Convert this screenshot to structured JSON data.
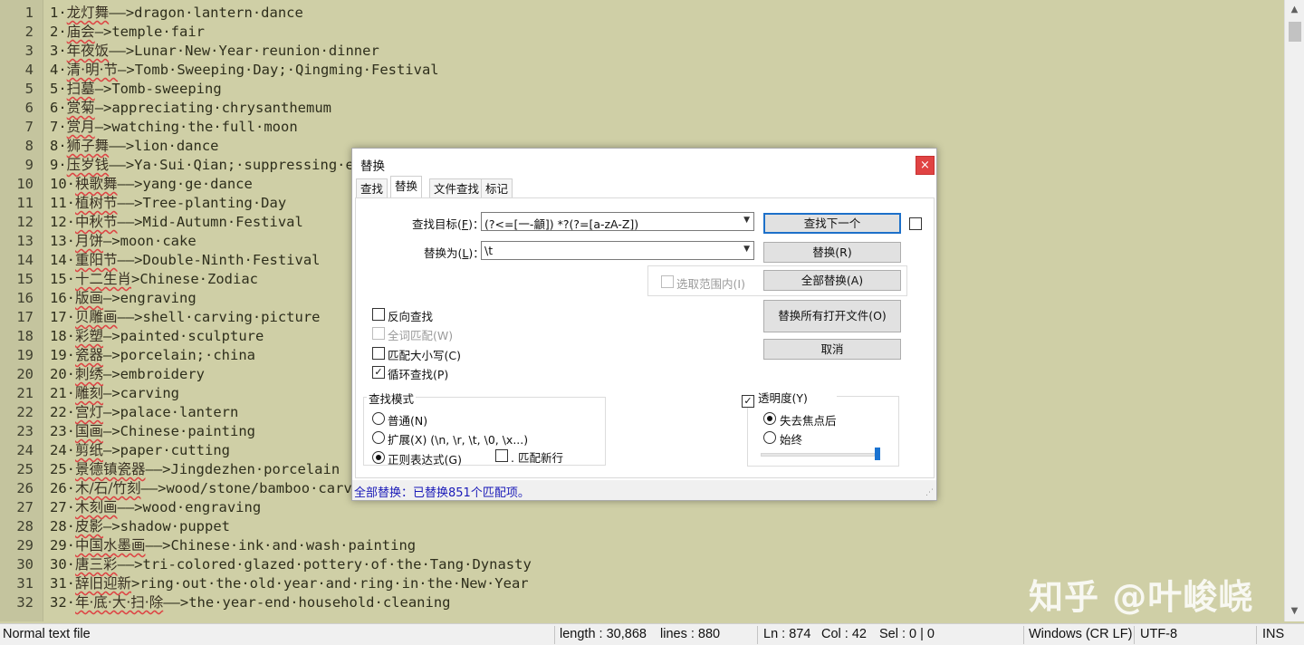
{
  "editor": {
    "lines": [
      {
        "no": "1",
        "pre": "1·",
        "zh": "龙灯舞",
        "post": "——>dragon·lantern·dance"
      },
      {
        "no": "2",
        "pre": "2·",
        "zh": "庙会",
        "post": "—>temple·fair"
      },
      {
        "no": "3",
        "pre": "3·",
        "zh": "年夜饭",
        "post": "——>Lunar·New·Year·reunion·dinner"
      },
      {
        "no": "4",
        "pre": "4·",
        "zh": "清·明·节",
        "post": "—>Tomb·Sweeping·Day;·Qingming·Festival"
      },
      {
        "no": "5",
        "pre": "5·",
        "zh": "扫墓",
        "post": "—>Tomb-sweeping"
      },
      {
        "no": "6",
        "pre": "6·",
        "zh": "赏菊",
        "post": "—>appreciating·chrysanthemum"
      },
      {
        "no": "7",
        "pre": "7·",
        "zh": "赏月",
        "post": "—>watching·the·full·moon"
      },
      {
        "no": "8",
        "pre": "8·",
        "zh": "狮子舞",
        "post": "——>lion·dance"
      },
      {
        "no": "9",
        "pre": "9·",
        "zh": "压岁钱",
        "post": "——>Ya·Sui·Qian;·suppressing·evil·spirits"
      },
      {
        "no": "10",
        "pre": "10·",
        "zh": "秧歌舞",
        "post": "——>yang·ge·dance"
      },
      {
        "no": "11",
        "pre": "11·",
        "zh": "植树节",
        "post": "——>Tree-planting·Day"
      },
      {
        "no": "12",
        "pre": "12·",
        "zh": "中秋节",
        "post": "——>Mid-Autumn·Festival"
      },
      {
        "no": "13",
        "pre": "13·",
        "zh": "月饼",
        "post": "—>moon·cake"
      },
      {
        "no": "14",
        "pre": "14·",
        "zh": "重阳节",
        "post": "——>Double-Ninth·Festival"
      },
      {
        "no": "15",
        "pre": "15·",
        "zh": "十二生肖",
        "post": ">Chinese·Zodiac"
      },
      {
        "no": "16",
        "pre": "16·",
        "zh": "版画",
        "post": "—>engraving"
      },
      {
        "no": "17",
        "pre": "17·",
        "zh": "贝雕画",
        "post": "——>shell·carving·picture"
      },
      {
        "no": "18",
        "pre": "18·",
        "zh": "彩塑",
        "post": "—>painted·sculpture"
      },
      {
        "no": "19",
        "pre": "19·",
        "zh": "瓷器",
        "post": "—>porcelain;·china"
      },
      {
        "no": "20",
        "pre": "20·",
        "zh": "刺绣",
        "post": "—>embroidery"
      },
      {
        "no": "21",
        "pre": "21·",
        "zh": "雕刻",
        "post": "—>carving"
      },
      {
        "no": "22",
        "pre": "22·",
        "zh": "宫灯",
        "post": "—>palace·lantern"
      },
      {
        "no": "23",
        "pre": "23·",
        "zh": "国画",
        "post": "—>Chinese·painting"
      },
      {
        "no": "24",
        "pre": "24·",
        "zh": "剪纸",
        "post": "—>paper·cutting"
      },
      {
        "no": "25",
        "pre": "25·",
        "zh": "景德镇瓷器",
        "post": "——>Jingdezhen·porcelain"
      },
      {
        "no": "26",
        "pre": "26·",
        "zh": "木/石/竹刻",
        "post": "——>wood/stone/bamboo·carving"
      },
      {
        "no": "27",
        "pre": "27·",
        "zh": "木刻画",
        "post": "——>wood·engraving"
      },
      {
        "no": "28",
        "pre": "28·",
        "zh": "皮影",
        "post": "—>shadow·puppet"
      },
      {
        "no": "29",
        "pre": "29·",
        "zh": "中国水墨画",
        "post": "——>Chinese·ink·and·wash·painting"
      },
      {
        "no": "30",
        "pre": "30·",
        "zh": "唐三彩",
        "post": "——>tri-colored·glazed·pottery·of·the·Tang·Dynasty"
      },
      {
        "no": "31",
        "pre": "31·",
        "zh": "辞旧迎新",
        "post": ">ring·out·the·old·year·and·ring·in·the·New·Year"
      },
      {
        "no": "32",
        "pre": "32·",
        "zh": "年·底·大·扫·除",
        "post": "——>the·year-end·household·cleaning"
      }
    ]
  },
  "dialog": {
    "title": "替换",
    "close": "×",
    "tabs": [
      "查找",
      "替换",
      "文件查找",
      "标记"
    ],
    "active_tab": "替换",
    "find_label": "查找目标(",
    "find_key": "F",
    "find_label_end": ")：",
    "find_value": "(?<=[一-龥]) *?(?=[a-zA-Z])",
    "replace_label": "替换为(",
    "replace_key": "L",
    "replace_label_end": ")：",
    "replace_value": "\\t",
    "in_selection": "选取范围内(I)",
    "options": {
      "backward": "反向查找",
      "whole_word": "全词匹配(W)",
      "match_case": "匹配大小写(C)",
      "wrap": "循环查找(P)"
    },
    "search_mode": {
      "title": "查找模式",
      "normal": "普通(N)",
      "extended": "扩展(X) (\\n, \\r, \\t, \\0, \\x...)",
      "regex": "正则表达式(G)",
      "dot_newline": ". 匹配新行"
    },
    "transparency": {
      "title": "透明度(Y)",
      "on_lose_focus": "失去焦点后",
      "always": "始终",
      "level": 0.97
    },
    "buttons": {
      "find_next": "查找下一个",
      "replace": "替换(R)",
      "replace_all": "全部替换(A)",
      "replace_all_open": "替换所有打开文件(O)",
      "cancel": "取消"
    },
    "status": "全部替换：已替换851个匹配项。"
  },
  "statusbar": {
    "file_type": "Normal text file",
    "length": "length : 30,868",
    "lines": "lines : 880",
    "ln": "Ln : 874",
    "col": "Col : 42",
    "sel": "Sel : 0 | 0",
    "eol": "Windows (CR LF)",
    "encoding": "UTF-8",
    "mode": "INS"
  },
  "watermark": "知乎 @叶峻峣"
}
